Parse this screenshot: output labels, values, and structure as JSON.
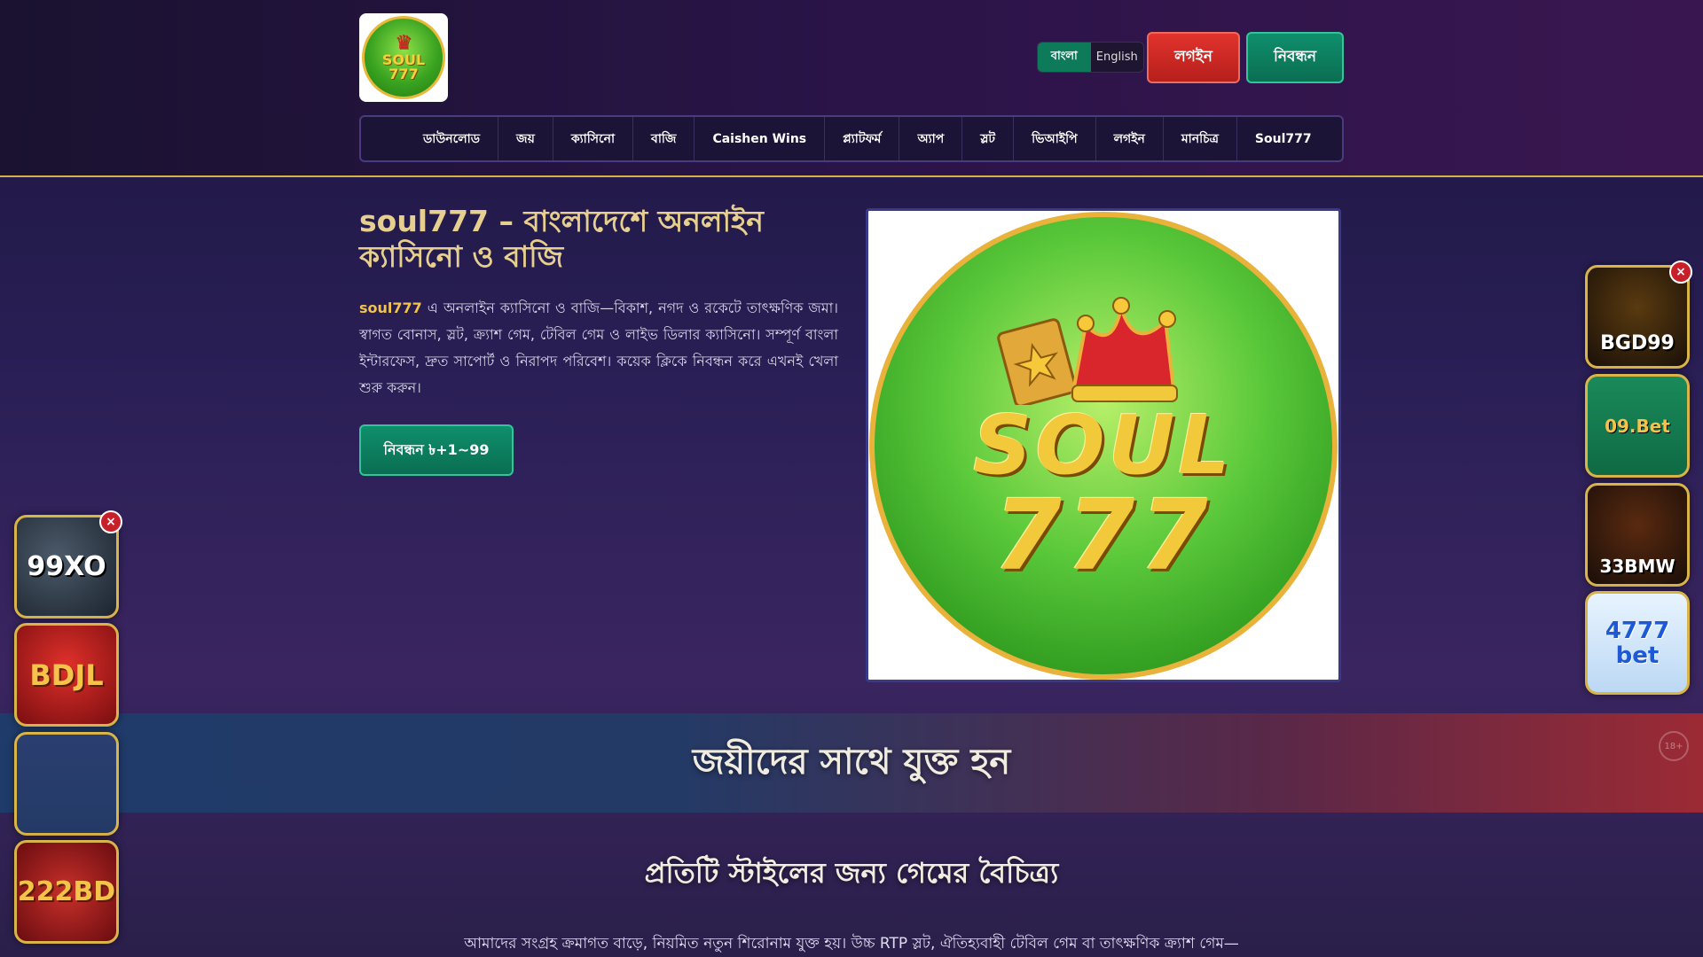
{
  "header": {
    "logo_text_top": "SOUL",
    "logo_text_bottom": "777",
    "lang_bn": "বাংলা",
    "lang_en": "English",
    "login": "লগইন",
    "register": "নিবন্ধন"
  },
  "nav": {
    "items": [
      "ডাউনলোড",
      "জয়",
      "ক্যাসিনো",
      "বাজি",
      "Caishen Wins",
      "প্ল্যাটফর্ম",
      "অ্যাপ",
      "স্লট",
      "ভিআইপি",
      "লগইন",
      "মানচিত্র",
      "Soul777"
    ]
  },
  "hero": {
    "title": "soul777 – বাংলাদেশে অনলাইন ক্যাসিনো ও বাজি",
    "brand": "soul777",
    "text": " এ অনলাইন ক্যাসিনো ও বাজি—বিকাশ, নগদ ও রকেটে তাৎক্ষণিক জমা। স্বাগত বোনাস, স্লট, ক্র্যাশ গেম, টেবিল গেম ও লাইভ ডিলার ক্যাসিনো। সম্পূর্ণ বাংলা ইন্টারফেস, দ্রুত সাপোর্ট ও নিরাপদ পরিবেশ। কয়েক ক্লিকে নিবন্ধন করে এখনই খেলা শুরু করুন।",
    "button": "নিবন্ধন ৳+1~99",
    "image_text_top": "SOUL",
    "image_text_bottom": "777"
  },
  "banner": {
    "title": "জয়ীদের সাথে যুক্ত হন",
    "icon_label": "18+"
  },
  "section": {
    "title": "প্রতিটি স্টাইলের জন্য গেমের বৈচিত্র্য",
    "text": "আমাদের সংগ্রহ ক্রমাগত বাড়ে, নিয়মিত নতুন শিরোনাম যুক্ত হয়। উচ্চ RTP স্লট, ঐতিহ্যবাহী টেবিল গেম বা তাৎক্ষণিক ক্র্যাশ গেম—"
  },
  "ads_left": [
    "99XO",
    "BDJL",
    "",
    "222BD"
  ],
  "ads_right": [
    "BGD99",
    "09.Bet",
    "33BMW",
    "4777 bet"
  ],
  "close_symbol": "×",
  "colors": {
    "accent_green": "#0f8f6c",
    "accent_red": "#e2332d",
    "gold": "#d8b449"
  }
}
